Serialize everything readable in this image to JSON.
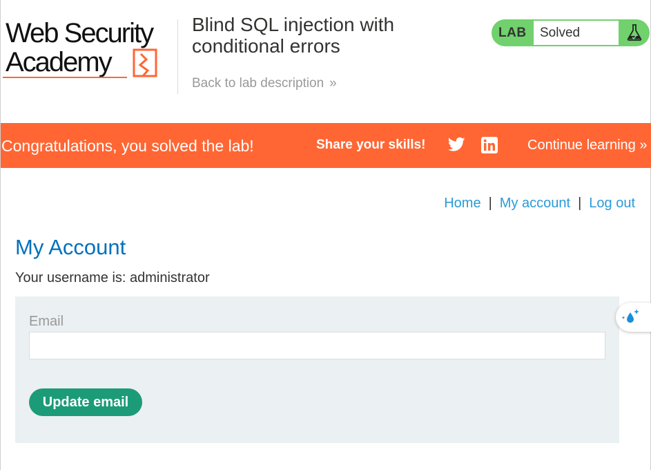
{
  "logo": {
    "line1": "Web Security",
    "line2": "Academy",
    "accent_color": "#ff6633"
  },
  "header": {
    "lab_title": "Blind SQL injection with conditional errors",
    "back_link": "Back to lab description",
    "back_chevron": "»"
  },
  "status": {
    "lab_label": "LAB",
    "state": "Solved",
    "icon": "flask-icon",
    "color": "#70d16d"
  },
  "banner": {
    "congrats": "Congratulations, you solved the lab!",
    "share": "Share your skills!",
    "twitter_icon": "twitter-icon",
    "linkedin_icon": "linkedin-icon",
    "continue": "Continue learning",
    "continue_chevron": "»",
    "color": "#ff6633"
  },
  "nav": {
    "home": "Home",
    "my_account": "My account",
    "log_out": "Log out",
    "separator": "|"
  },
  "main": {
    "title": "My Account",
    "username_text": "Your username is: administrator",
    "email_label": "Email",
    "email_value": "",
    "update_button": "Update email",
    "button_color": "#1c9b78"
  },
  "widget": {
    "icon": "sparkle-drop-icon"
  }
}
